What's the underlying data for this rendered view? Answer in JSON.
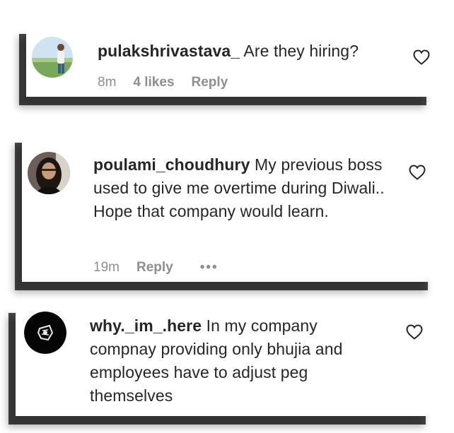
{
  "comments": [
    {
      "username": "pulakshrivastava_",
      "text": "Are they hiring?",
      "time": "8m",
      "likes": "4 likes",
      "reply_label": "Reply",
      "avatar": "person-outdoor-photo"
    },
    {
      "username": "poulami_choudhury",
      "text": "My previous boss used to give me overtime during Diwali.. Hope that company would learn.",
      "time": "19m",
      "reply_label": "Reply",
      "more_label": "•••",
      "avatar": "woman-portrait-photo"
    },
    {
      "username": "why._im_.here",
      "text": "In my company compnay providing only bhujia and employees have to adjust peg themselves",
      "avatar": "black-logo-icon"
    }
  ],
  "icons": {
    "like": "heart-outline-icon"
  },
  "colors": {
    "text": "#262626",
    "muted": "#8e8e8e",
    "shadow": "#1a1a1a"
  }
}
